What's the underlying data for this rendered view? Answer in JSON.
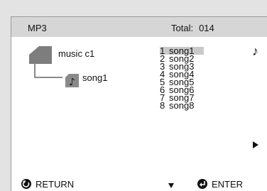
{
  "header": {
    "title": "MP3",
    "total_label": "Total:",
    "total_value": "014"
  },
  "tree": {
    "folder": {
      "label": "music c1",
      "icon": "folder-icon"
    },
    "file": {
      "label": "song1",
      "icon": "music-file-icon"
    }
  },
  "songs": [
    {
      "index": "1",
      "title": "song1",
      "selected": true
    },
    {
      "index": "2",
      "title": "song2"
    },
    {
      "index": "3",
      "title": "song3"
    },
    {
      "index": "4",
      "title": "song4"
    },
    {
      "index": "5",
      "title": "song5"
    },
    {
      "index": "6",
      "title": "song6"
    },
    {
      "index": "7",
      "title": "song7"
    },
    {
      "index": "8",
      "title": "song8"
    }
  ],
  "footer": {
    "return_label": "RETURN",
    "enter_label": "ENTER",
    "return_icon": "return-icon",
    "enter_icon": "enter-icon"
  },
  "colors": {
    "header_bg": "#d6d6d6",
    "page_bg": "#e3e3e3",
    "selection_bg": "#c9c9c9"
  }
}
